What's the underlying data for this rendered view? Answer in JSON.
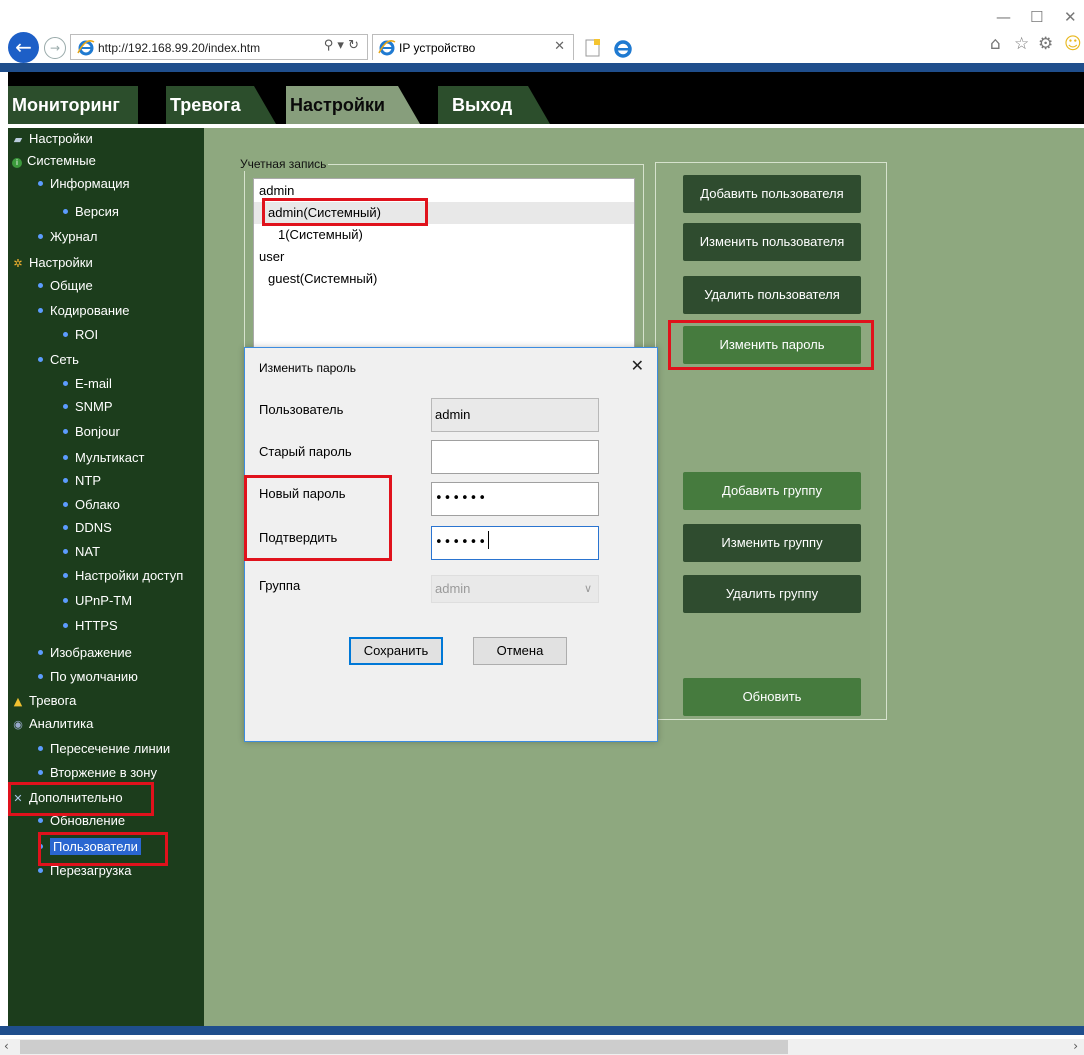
{
  "browser": {
    "url": "http://192.168.99.20/index.htm",
    "tab_title": "IP устройство"
  },
  "nav": {
    "tabs": [
      "Мониторинг",
      "Тревога",
      "Настройки",
      "Выход"
    ],
    "active": "Настройки"
  },
  "sidebar": {
    "items": [
      {
        "label": "Настройки",
        "icon": "book-icon"
      },
      {
        "label": "Системные",
        "icon": "info-icon"
      },
      {
        "label": "Информация"
      },
      {
        "label": "Версия"
      },
      {
        "label": "Журнал"
      },
      {
        "label": "Настройки",
        "icon": "gear-icon"
      },
      {
        "label": "Общие"
      },
      {
        "label": "Кодирование"
      },
      {
        "label": "ROI"
      },
      {
        "label": "Сеть"
      },
      {
        "label": "E-mail"
      },
      {
        "label": "SNMP"
      },
      {
        "label": "Bonjour"
      },
      {
        "label": "Мультикаст"
      },
      {
        "label": "NTP"
      },
      {
        "label": "Облако"
      },
      {
        "label": "DDNS"
      },
      {
        "label": "NAT"
      },
      {
        "label": "Настройки доступ"
      },
      {
        "label": "UPnP-TM"
      },
      {
        "label": "HTTPS"
      },
      {
        "label": "Изображение"
      },
      {
        "label": "По умолчанию"
      },
      {
        "label": "Тревога",
        "icon": "alarm-icon"
      },
      {
        "label": "Аналитика",
        "icon": "analytics-icon"
      },
      {
        "label": "Пересечение линии"
      },
      {
        "label": "Вторжение в зону"
      },
      {
        "label": "Дополнительно",
        "icon": "tools-icon"
      },
      {
        "label": "Обновление"
      },
      {
        "label": "Пользователи"
      },
      {
        "label": "Перезагрузка"
      }
    ],
    "selected": "Пользователи"
  },
  "accounts": {
    "legend": "Учетная запись",
    "rows": [
      "admin",
      "admin(Системный)",
      "1(Системный)",
      "user",
      "guest(Системный)"
    ],
    "selected": "admin(Системный)"
  },
  "buttons": {
    "add_user": "Добавить пользователя",
    "edit_user": "Изменить пользователя",
    "delete_user": "Удалить пользователя",
    "change_password": "Изменить пароль",
    "add_group": "Добавить группу",
    "edit_group": "Изменить группу",
    "delete_group": "Удалить группу",
    "refresh": "Обновить"
  },
  "dialog": {
    "title": "Изменить пароль",
    "user_label": "Пользователь",
    "user_value": "admin",
    "old_password_label": "Старый пароль",
    "old_password_value": "",
    "new_password_label": "Новый пароль",
    "new_password_value": "••••••",
    "confirm_label": "Подтвердить",
    "confirm_value": "••••••",
    "group_label": "Группа",
    "group_value": "admin",
    "save": "Сохранить",
    "cancel": "Отмена"
  },
  "colors": {
    "sidebar_bg": "#1c3d1c",
    "content_bg": "#8ea87f",
    "highlight": "#e0121c",
    "selection": "#2a66d0"
  }
}
